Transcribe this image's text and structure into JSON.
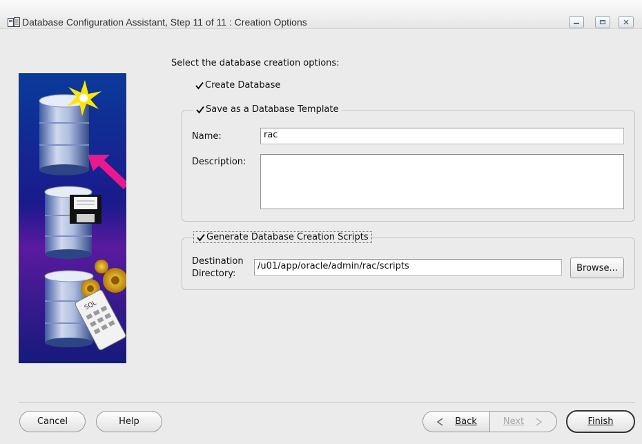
{
  "window": {
    "title": "Database Configuration Assistant, Step 11 of 11 : Creation Options"
  },
  "main": {
    "heading": "Select the database creation options:",
    "create_database": {
      "label": "Create Database",
      "checked": true
    },
    "template_group": {
      "label": "Save as a Database Template",
      "checked": true,
      "name_label": "Name:",
      "name_value": "rac",
      "description_label": "Description:",
      "description_value": ""
    },
    "scripts_group": {
      "label": "Generate Database Creation Scripts",
      "checked": true,
      "destination_label_line1": "Destination",
      "destination_label_line2": "Directory:",
      "destination_value": "/u01/app/oracle/admin/rac/scripts",
      "browse_label": "Browse..."
    }
  },
  "footer": {
    "cancel_label": "Cancel",
    "help_label": "Help",
    "back_label": "Back",
    "next_label": "Next",
    "finish_label": "Finish"
  },
  "colors": {
    "window_bg": "#ebebeb",
    "image_bg": "#1a1a8c",
    "arrow": "#e8188f",
    "star": "#ffe600"
  },
  "icons": [
    "app-icon",
    "minimize-icon",
    "maximize-icon",
    "close-icon",
    "checkmark-icon",
    "back-arrow-icon",
    "next-arrow-icon",
    "database-illustration"
  ]
}
